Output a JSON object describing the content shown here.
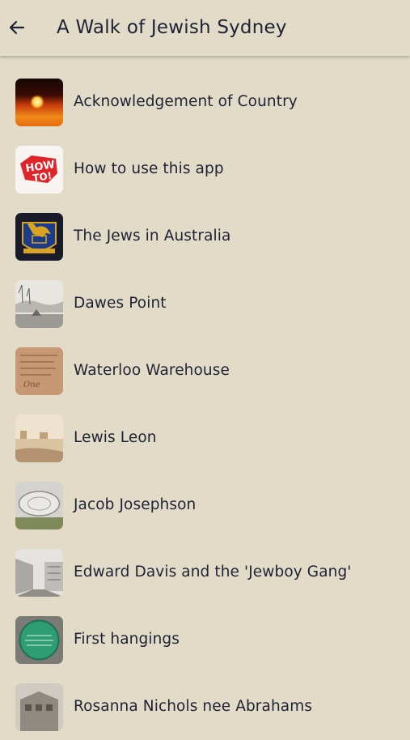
{
  "header": {
    "title": "A Walk of Jewish Sydney",
    "back_icon": "arrow-left-icon"
  },
  "colors": {
    "background": "#e1dbc8",
    "text": "#1f2235"
  },
  "items": [
    {
      "label": "Acknowledgement of Country",
      "icon": "sunset-thumbnail"
    },
    {
      "label": "How to use this app",
      "icon": "how-to-thumbnail"
    },
    {
      "label": "The Jews in Australia",
      "icon": "kangaroo-crest-thumbnail"
    },
    {
      "label": "Dawes Point",
      "icon": "sketch-harbour-thumbnail"
    },
    {
      "label": "Waterloo Warehouse",
      "icon": "parchment-thumbnail"
    },
    {
      "label": "Lewis Leon",
      "icon": "painting-thumbnail"
    },
    {
      "label": "Jacob Josephson",
      "icon": "fountain-thumbnail"
    },
    {
      "label": "Edward Davis and the 'Jewboy Gang'",
      "icon": "street-etching-thumbnail"
    },
    {
      "label": "First hangings",
      "icon": "green-plaque-thumbnail"
    },
    {
      "label": "Rosanna Nichols nee Abrahams",
      "icon": "old-building-thumbnail"
    }
  ]
}
